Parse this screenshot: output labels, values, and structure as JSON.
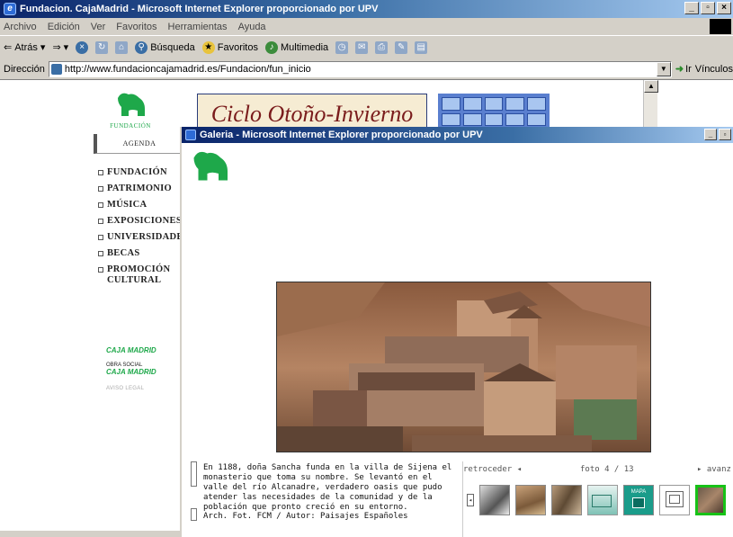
{
  "browser": {
    "title": "Fundacion. CajaMadrid - Microsoft Internet Explorer proporcionado por UPV",
    "menu": [
      "Archivo",
      "Edición",
      "Ver",
      "Favoritos",
      "Herramientas",
      "Ayuda"
    ],
    "toolbar": {
      "back": "Atrás",
      "search": "Búsqueda",
      "favorites": "Favoritos",
      "multimedia": "Multimedia"
    },
    "address_label": "Dirección",
    "address_value": "http://www.fundacioncajamadrid.es/Fundacion/fun_inicio",
    "go_label": "Ir",
    "links_label": "Vínculos"
  },
  "site": {
    "logo_text": "FUNDACIÓN",
    "banner_text": "Ciclo Otoño-Invierno",
    "agenda": "AGENDA",
    "nav": [
      "FUNDACIÓN",
      "PATRIMONIO",
      "MÚSICA",
      "EXPOSICIONES",
      "UNIVERSIDADES",
      "BECAS"
    ],
    "nav_promo_line1": "PROMOCIÓN",
    "nav_promo_line2": "CULTURAL",
    "caja_madrid": "CAJA MADRID",
    "obra_social": "OBRA SOCIAL",
    "caja_madrid_2": "CAJA MADRID",
    "aviso_legal": "AVISO LEGAL"
  },
  "popup": {
    "title": "Galeria - Microsoft Internet Explorer proporcionado por UPV",
    "caption": "En 1188, doña Sancha funda en la villa de Sijena el monasterio que toma su nombre. Se levantó en el valle del río Alcanadre, verdadero oasis que pudo atender las necesidades de la comunidad y de la población que pronto creció en su entorno.",
    "credit": "Arch. Fot. FCM / Autor: Paisajes Españoles",
    "retroceder": "retroceder",
    "foto_counter": "foto 4 / 13",
    "avanzar": "avanz",
    "mapa_label": "MAPA"
  },
  "colors": {
    "brand_green": "#1ea84a",
    "selected_thumb": "#17c217",
    "titlebar": "#0a246a"
  }
}
